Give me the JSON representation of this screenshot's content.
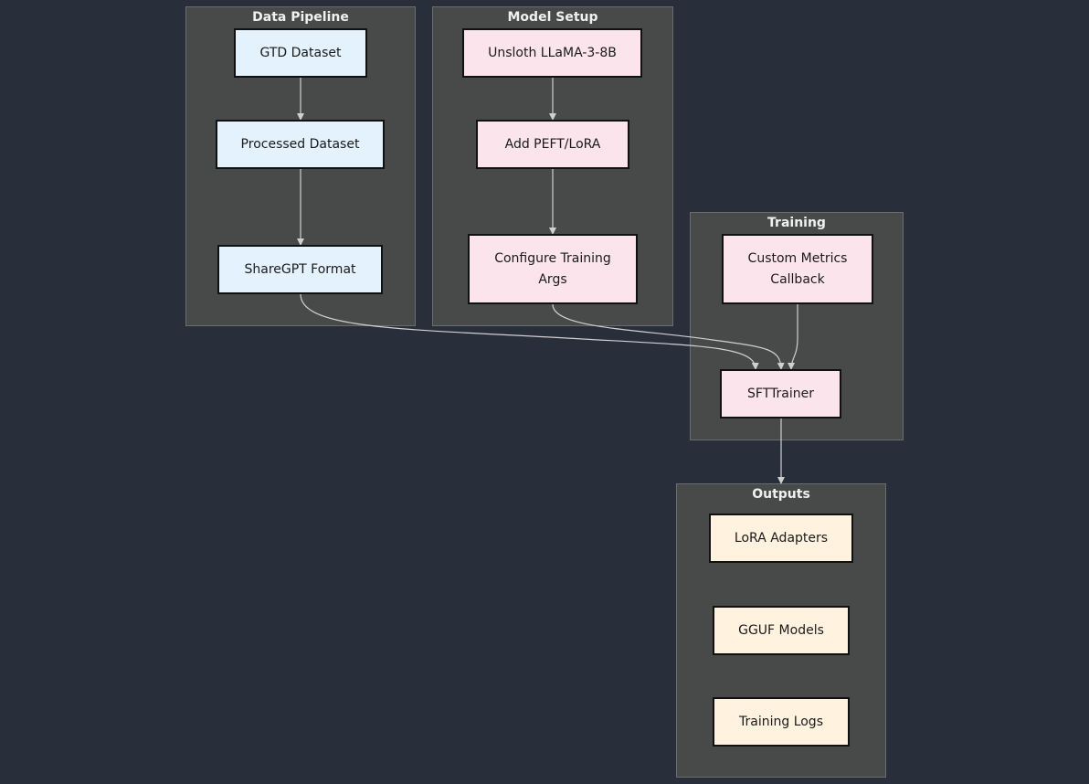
{
  "clusters": {
    "data_pipeline": {
      "title": "Data Pipeline"
    },
    "model_setup": {
      "title": "Model Setup"
    },
    "training": {
      "title": "Training"
    },
    "outputs": {
      "title": "Outputs"
    }
  },
  "nodes": {
    "gtd_dataset": "GTD Dataset",
    "processed_dataset": "Processed Dataset",
    "sharegpt_format": "ShareGPT Format",
    "unsloth_llama": "Unsloth LLaMA-3-8B",
    "add_peft_lora": "Add PEFT/LoRA",
    "configure_training_args": "Configure Training Args",
    "custom_metrics_callback": "Custom Metrics Callback",
    "sfttrainer": "SFTTrainer",
    "lora_adapters": "LoRA Adapters",
    "gguf_models": "GGUF Models",
    "training_logs": "Training Logs"
  },
  "edges": [
    {
      "from": "GTD Dataset",
      "to": "Processed Dataset"
    },
    {
      "from": "Processed Dataset",
      "to": "ShareGPT Format"
    },
    {
      "from": "Unsloth LLaMA-3-8B",
      "to": "Add PEFT/LoRA"
    },
    {
      "from": "Add PEFT/LoRA",
      "to": "Configure Training Args"
    },
    {
      "from": "ShareGPT Format",
      "to": "SFTTrainer"
    },
    {
      "from": "Configure Training Args",
      "to": "SFTTrainer"
    },
    {
      "from": "Custom Metrics Callback",
      "to": "SFTTrainer"
    },
    {
      "from": "SFTTrainer",
      "to": "Outputs"
    }
  ],
  "colors": {
    "background": "#282e3a",
    "cluster_fill": "#484a49",
    "data_node": "#e3f2fd",
    "model_node": "#fce4ec",
    "output_node": "#fff3e0",
    "edge": "#d0d0d0"
  }
}
